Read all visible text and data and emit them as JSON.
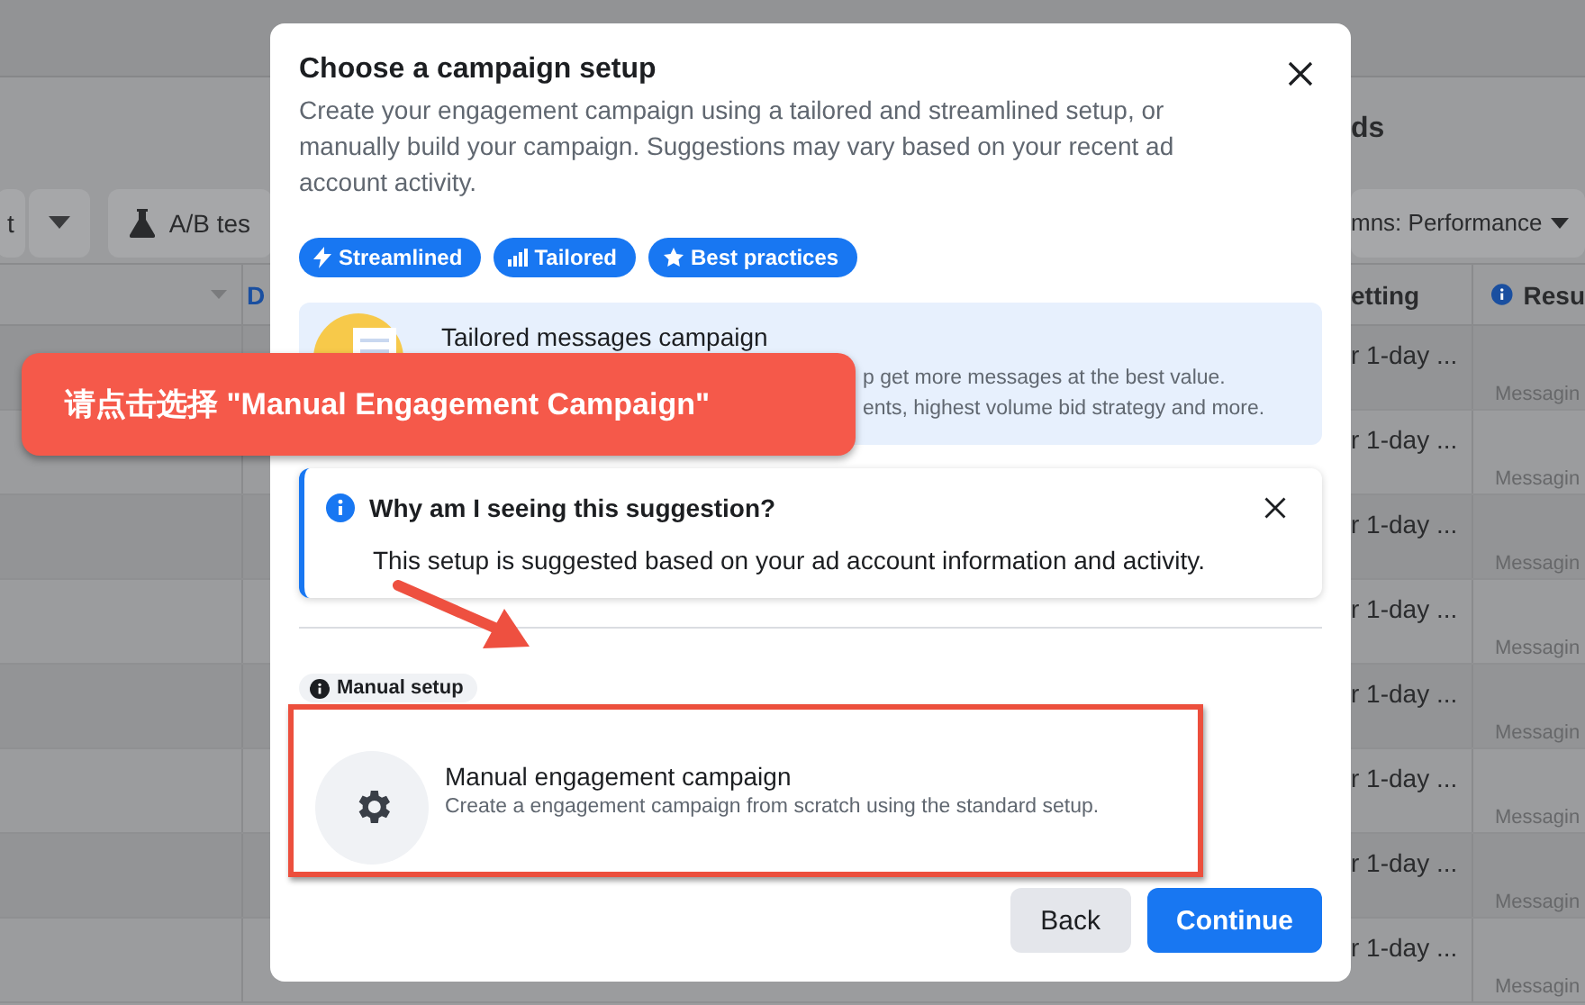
{
  "background": {
    "toolbar": {
      "first_button": "t",
      "ab_test_button": "A/B tes",
      "columns_button": "mns: Performance"
    },
    "heading": "ds",
    "table": {
      "column_2": "D",
      "column_4": "etting",
      "column_5": "Resu",
      "rows": [
        {
          "cell_4": "r 1-day ...",
          "cell_5": "Messagin"
        },
        {
          "cell_4": "r 1-day ...",
          "cell_5": "Messagin"
        },
        {
          "cell_4": "r 1-day ...",
          "cell_5": "Messagin"
        },
        {
          "cell_4": "r 1-day ...",
          "cell_5": "Messagin"
        },
        {
          "cell_4": "r 1-day ...",
          "cell_5": "Messagin"
        },
        {
          "cell_4": "r 1-day ...",
          "cell_5": "Messagin"
        },
        {
          "cell_4": "r 1-day ...",
          "cell_5": "Messagin"
        },
        {
          "cell_4": "r 1-day ...",
          "cell_5": "Messagin"
        }
      ]
    }
  },
  "modal": {
    "title": "Choose a campaign setup",
    "description": "Create your engagement campaign using a tailored and streamlined setup, or manually build your campaign. Suggestions may vary based on your recent ad account activity.",
    "tags": [
      {
        "label": "Streamlined",
        "kind": "bolt"
      },
      {
        "label": "Tailored",
        "kind": "chart"
      },
      {
        "label": "Best practices",
        "kind": "star"
      }
    ],
    "suggestion": {
      "title": "Tailored messages campaign",
      "description_lines": [
        "p get more messages at the best value.",
        "ents, highest volume bid strategy and more."
      ]
    },
    "why": {
      "title": "Why am I seeing this suggestion?",
      "text": "This setup is suggested based on your ad account information and activity."
    },
    "manual": {
      "badge": "Manual setup",
      "title": "Manual engagement campaign",
      "description": "Create a engagement campaign from scratch using the standard setup."
    },
    "buttons": [
      {
        "label": "Back",
        "kind": "secondary"
      },
      {
        "label": "Continue",
        "kind": "primary"
      }
    ]
  },
  "annotation": {
    "callout": "请点击选择 \"Manual Engagement Campaign\""
  }
}
